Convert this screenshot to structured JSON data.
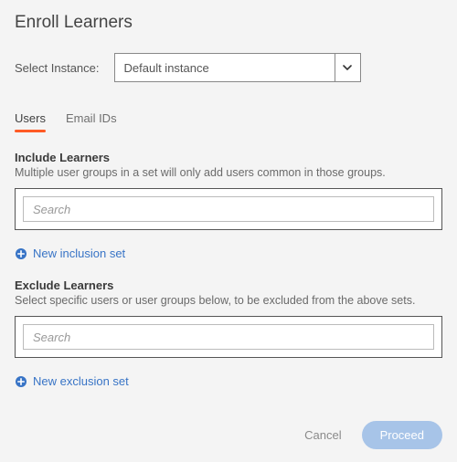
{
  "title": "Enroll Learners",
  "instance": {
    "label": "Select Instance:",
    "selected": "Default instance"
  },
  "tabs": {
    "users": "Users",
    "emailIds": "Email IDs"
  },
  "include": {
    "heading": "Include Learners",
    "description": "Multiple user groups in a set will only add users common in those groups.",
    "search_placeholder": "Search",
    "add_link": "New inclusion set"
  },
  "exclude": {
    "heading": "Exclude Learners",
    "description": "Select specific users or user groups below, to be excluded from the above sets.",
    "search_placeholder": "Search",
    "add_link": "New exclusion set"
  },
  "footer": {
    "cancel": "Cancel",
    "proceed": "Proceed"
  }
}
